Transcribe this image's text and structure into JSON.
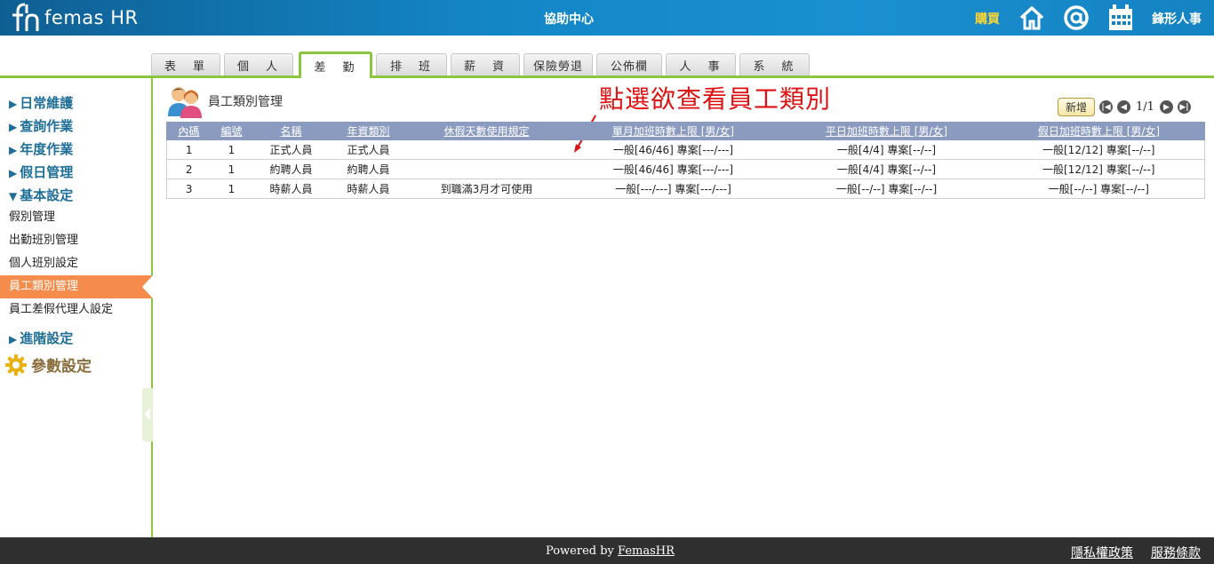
{
  "header": {
    "logo_text": "femas HR",
    "help_center": "協助中心",
    "buy": "購買",
    "company": "鋒形人事"
  },
  "tabs": [
    "表　單",
    "個　人",
    "差　勤",
    "排　班",
    "薪　資",
    "保險勞退",
    "公佈欄",
    "人　事",
    "系　統"
  ],
  "sidebar": {
    "headings": [
      "日常維護",
      "查詢作業",
      "年度作業",
      "假日管理",
      "基本設定",
      "進階設定"
    ],
    "items": [
      "假別管理",
      "出勤班別管理",
      "個人班別設定",
      "員工類別管理",
      "員工差假代理人設定"
    ],
    "param": "參數設定"
  },
  "main": {
    "title": "員工類別管理",
    "annotation": "點選欲查看員工類別",
    "add_label": "新增",
    "page_info": "1/1",
    "columns": [
      "內碼",
      "編號",
      "名稱",
      "年資類別",
      "休假天數使用規定",
      "單月加班時數上限 [男/女]",
      "平日加班時數上限 [男/女]",
      "假日加班時數上限 [男/女]"
    ],
    "rows": [
      [
        "1",
        "1",
        "正式人員",
        "正式人員",
        "",
        "一般[46/46] 專案[---/---]",
        "一般[4/4] 專案[--/--]",
        "一般[12/12] 專案[--/--]"
      ],
      [
        "2",
        "1",
        "約聘人員",
        "約聘人員",
        "",
        "一般[46/46] 專案[---/---]",
        "一般[4/4] 專案[--/--]",
        "一般[12/12] 專案[--/--]"
      ],
      [
        "3",
        "1",
        "時薪人員",
        "時薪人員",
        "到職滿3月才可使用",
        "一般[---/---] 專案[---/---]",
        "一般[--/--] 專案[--/--]",
        "一般[--/--] 專案[--/--]"
      ]
    ]
  },
  "footer": {
    "powered_prefix": "Powered by ",
    "powered_link": "FemasHR",
    "privacy": "隱私權政策",
    "terms": "服務條款"
  },
  "colors": {
    "header_blue": "#1386c6",
    "accent_green": "#8cc63f",
    "active_item": "#f58c4b",
    "table_header": "#8a9bbf",
    "annotation_red": "#dd1111"
  }
}
